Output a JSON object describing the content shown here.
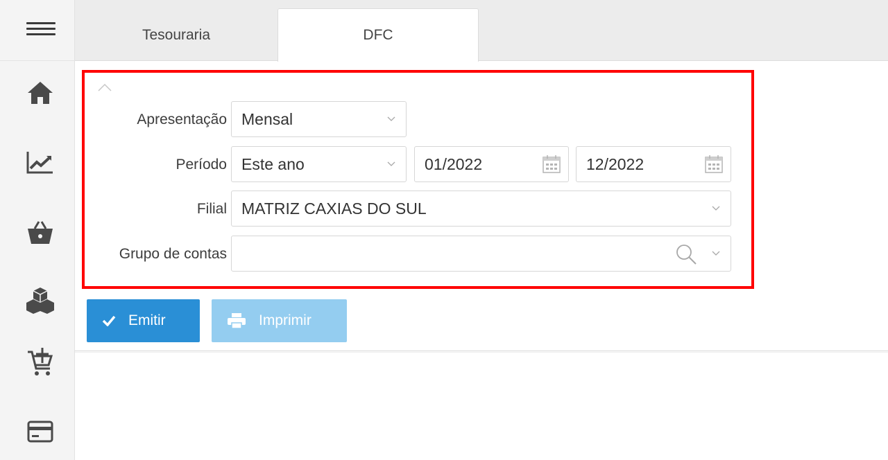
{
  "sidebar": {
    "menu_icon": "hamburger-menu-icon",
    "items": [
      {
        "icon": "home-icon"
      },
      {
        "icon": "chart-line-icon"
      },
      {
        "icon": "shopping-basket-icon"
      },
      {
        "icon": "cubes-icon"
      },
      {
        "icon": "cart-plus-icon"
      },
      {
        "icon": "credit-card-icon"
      }
    ]
  },
  "tabs": [
    {
      "label": "Tesouraria",
      "active": false
    },
    {
      "label": "DFC",
      "active": true
    }
  ],
  "filters": {
    "apresentacao": {
      "label": "Apresentação",
      "value": "Mensal"
    },
    "periodo": {
      "label": "Período",
      "value": "Este ano",
      "start": "01/2022",
      "end": "12/2022"
    },
    "filial": {
      "label": "Filial",
      "value": "MATRIZ CAXIAS DO SUL"
    },
    "grupo_contas": {
      "label": "Grupo de contas",
      "value": ""
    }
  },
  "buttons": {
    "emitir": "Emitir",
    "imprimir": "Imprimir"
  },
  "colors": {
    "primary": "#2a8fd6",
    "primary_disabled": "#94cdf0",
    "highlight_border": "#ff0000",
    "icon": "#4a4a4a"
  }
}
